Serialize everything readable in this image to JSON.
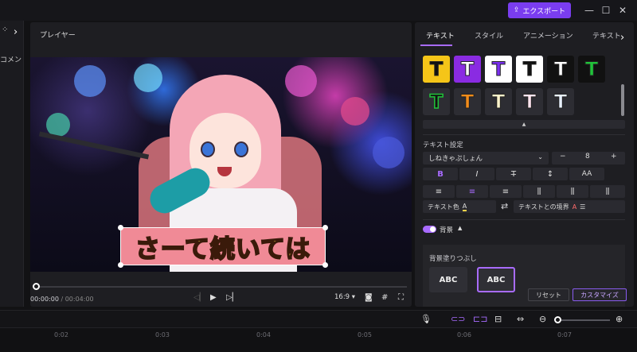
{
  "titlebar": {
    "export_label": "エクスポート",
    "minimize": "—",
    "maximize": "☐",
    "close": "✕"
  },
  "leftrail": {
    "label": "コメン"
  },
  "player": {
    "title": "プレイヤー",
    "caption": "さーて続いては",
    "current_time": "00:00:00",
    "separator": " / ",
    "total_time": "00:04:00",
    "aspect_ratio": "16:9",
    "progress": 0
  },
  "panel": {
    "tabs": [
      "テキスト",
      "スタイル",
      "アニメーション",
      "テキスト"
    ],
    "active_tab": 0,
    "style_presets_row1": [
      {
        "letter": "T",
        "fg": "#111111",
        "bg": "#f5c518"
      },
      {
        "letter": "T",
        "fg": "#ffffff",
        "bg": "#8a2be2"
      },
      {
        "letter": "T",
        "fg": "#7b2ff2",
        "bg": "#ffffff"
      },
      {
        "letter": "T",
        "fg": "#111111",
        "bg": "#ffffff"
      },
      {
        "letter": "T",
        "fg": "#ffffff",
        "bg": "#111111"
      },
      {
        "letter": "T",
        "fg": "#21c43a",
        "bg": "#111111"
      }
    ],
    "style_presets_row2": [
      {
        "letter": "T",
        "fg": "#111111",
        "bg": "#2d2d33",
        "stroke": "#21c43a"
      },
      {
        "letter": "T",
        "fg": "#f28c1a",
        "bg": "#2d2d33"
      },
      {
        "letter": "T",
        "fg": "#fff4cc",
        "bg": "#2d2d33"
      },
      {
        "letter": "T",
        "fg": "#ffe5ef",
        "bg": "#2d2d33"
      },
      {
        "letter": "T",
        "fg": "#e8f0ff",
        "bg": "#2d2d33"
      }
    ],
    "collapse_glyph": "▲",
    "text_settings_label": "テキスト設定",
    "font_name": "しねきゃぷしょん",
    "font_size": "8",
    "minus": "−",
    "plus": "+",
    "format_row1": [
      "B",
      "I",
      "T̶",
      "↕",
      "AA"
    ],
    "format_row2": [
      "≡",
      "≡",
      "≡",
      "⫼",
      "⫼",
      "⫼"
    ],
    "text_color_label": "テキスト色",
    "text_color_glyph": "A",
    "border_label": "テキストとの境界",
    "swap_glyph": "⇄",
    "background_label": "背景",
    "background_caret": "▲",
    "background_enabled": true,
    "bg_fill_label": "背景塗りつぶし",
    "bg_fill_options": [
      "ABC",
      "ABC"
    ],
    "reset_label": "リセット",
    "customize_label": "カスタマイズ"
  },
  "timeline": {
    "ticks": [
      "0:02",
      "0:03",
      "0:04",
      "0:05",
      "0:06",
      "0:07"
    ]
  },
  "colors": {
    "accent": "#a86bff",
    "export_bg": "#7a3df0"
  }
}
